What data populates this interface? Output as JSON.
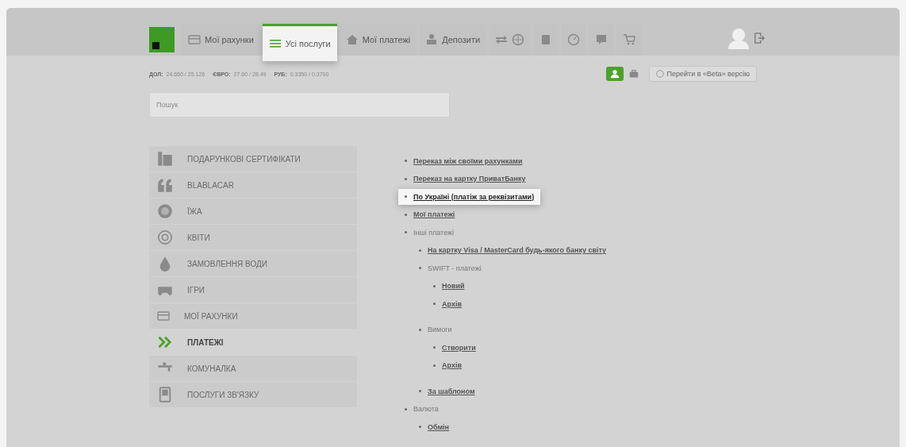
{
  "nav": {
    "tabs": [
      {
        "kind": "logo",
        "selected": false
      },
      {
        "kind": "text",
        "label": "Мої рахунки",
        "selected": false
      },
      {
        "kind": "text",
        "label": "Усі послуги",
        "selected": true
      },
      {
        "kind": "text",
        "label": "Мої платежі",
        "selected": false
      },
      {
        "kind": "text",
        "label": "Депозити",
        "selected": false
      },
      {
        "kind": "icons",
        "selected": false
      },
      {
        "kind": "icons",
        "selected": false
      },
      {
        "kind": "icons",
        "selected": false
      },
      {
        "kind": "icons",
        "selected": false
      },
      {
        "kind": "icons",
        "selected": false
      }
    ]
  },
  "rates": [
    {
      "label": "ДОЛ:",
      "value": "24.650 / 25.126"
    },
    {
      "label": "ЄВРО:",
      "value": "27.60 / 28.49"
    },
    {
      "label": "РУБ:",
      "value": "0.3350 / 0.3700"
    }
  ],
  "modes": [
    {
      "selected": true
    },
    {
      "selected": false
    }
  ],
  "beta_button": {
    "label": "Перейти в «Beta» версію"
  },
  "search": {
    "placeholder": "Пошук"
  },
  "sidebar": {
    "items": [
      {
        "label": "ПОДАРУНКОВІ СЕРТИФІКАТИ",
        "selected": false
      },
      {
        "label": "BLABLACAR",
        "selected": false
      },
      {
        "label": "ЇЖА",
        "selected": false
      },
      {
        "label": "КВІТИ",
        "selected": false
      },
      {
        "label": "ЗАМОВЛЕННЯ ВОДИ",
        "selected": false
      },
      {
        "label": "ІГРИ",
        "selected": false
      },
      {
        "label": "МОЇ РАХУНКИ",
        "selected": false
      },
      {
        "label": "ПЛАТЕЖІ",
        "selected": true
      },
      {
        "label": "КОМУНАЛКА",
        "selected": false
      },
      {
        "label": "ПОСЛУГИ ЗВ'ЯЗКУ",
        "selected": false
      }
    ]
  },
  "menu": [
    {
      "kind": "link",
      "label": "Переказ між своїми рахунками",
      "highlighted": false
    },
    {
      "kind": "link",
      "label": "Переказ на картку ПриватБанку",
      "highlighted": false
    },
    {
      "kind": "link",
      "label": "По Україні (платіж за реквізитами)",
      "highlighted": true
    },
    {
      "kind": "link",
      "label": "Мої платежі",
      "highlighted": false
    },
    {
      "kind": "group",
      "label": "Інші платежі",
      "highlighted": false,
      "children": [
        {
          "kind": "link",
          "label": "На картку Visa / MasterCard будь-якого банку світу",
          "highlighted": false
        },
        {
          "kind": "group",
          "label": "SWIFT - платежі",
          "highlighted": false,
          "children": [
            {
              "kind": "link",
              "label": "Новий",
              "highlighted": false
            },
            {
              "kind": "link",
              "label": "Архів",
              "highlighted": false
            }
          ]
        },
        {
          "kind": "group",
          "label": "Вимоги",
          "highlighted": false,
          "children": [
            {
              "kind": "link",
              "label": "Створити",
              "highlighted": false
            },
            {
              "kind": "link",
              "label": "Архів",
              "highlighted": false
            }
          ]
        },
        {
          "kind": "link",
          "label": "За шаблоном",
          "highlighted": false
        }
      ]
    },
    {
      "kind": "group",
      "label": "Валюта",
      "highlighted": false,
      "children": [
        {
          "kind": "link",
          "label": "Обмін",
          "highlighted": false
        }
      ]
    }
  ]
}
